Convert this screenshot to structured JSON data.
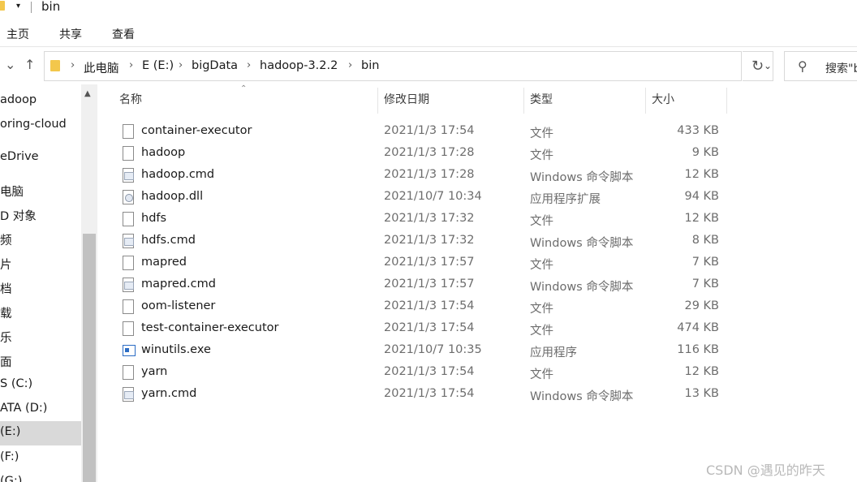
{
  "window": {
    "title": "bin"
  },
  "ribbon": {
    "tabs": [
      "主页",
      "共享",
      "查看"
    ]
  },
  "address": {
    "crumbs": [
      "此电脑",
      "E (E:)",
      "bigData",
      "hadoop-3.2.2",
      "bin"
    ]
  },
  "search": {
    "placeholder": "搜索\"b"
  },
  "sidebar": {
    "items": [
      {
        "label": "adoop"
      },
      {
        "label": "oring-cloud"
      },
      {
        "label": "eDrive"
      },
      {
        "label": "电脑"
      },
      {
        "label": "D 对象"
      },
      {
        "label": "频"
      },
      {
        "label": "片"
      },
      {
        "label": "档"
      },
      {
        "label": "载"
      },
      {
        "label": "乐"
      },
      {
        "label": "面"
      },
      {
        "label": "S (C:)"
      },
      {
        "label": "ATA (D:)"
      },
      {
        "label": "(E:)",
        "selected": true
      },
      {
        "label": "(F:)"
      },
      {
        "label": "(G:)"
      }
    ]
  },
  "columns": {
    "name": "名称",
    "date": "修改日期",
    "type": "类型",
    "size": "大小"
  },
  "files": [
    {
      "name": "container-executor",
      "date": "2021/1/3 17:54",
      "type": "文件",
      "size": "433 KB",
      "icon": "file-icon"
    },
    {
      "name": "hadoop",
      "date": "2021/1/3 17:28",
      "type": "文件",
      "size": "9 KB",
      "icon": "file-icon"
    },
    {
      "name": "hadoop.cmd",
      "date": "2021/1/3 17:28",
      "type": "Windows 命令脚本",
      "size": "12 KB",
      "icon": "cmd-file-icon"
    },
    {
      "name": "hadoop.dll",
      "date": "2021/10/7 10:34",
      "type": "应用程序扩展",
      "size": "94 KB",
      "icon": "dll-file-icon"
    },
    {
      "name": "hdfs",
      "date": "2021/1/3 17:32",
      "type": "文件",
      "size": "12 KB",
      "icon": "file-icon"
    },
    {
      "name": "hdfs.cmd",
      "date": "2021/1/3 17:32",
      "type": "Windows 命令脚本",
      "size": "8 KB",
      "icon": "cmd-file-icon"
    },
    {
      "name": "mapred",
      "date": "2021/1/3 17:57",
      "type": "文件",
      "size": "7 KB",
      "icon": "file-icon"
    },
    {
      "name": "mapred.cmd",
      "date": "2021/1/3 17:57",
      "type": "Windows 命令脚本",
      "size": "7 KB",
      "icon": "cmd-file-icon"
    },
    {
      "name": "oom-listener",
      "date": "2021/1/3 17:54",
      "type": "文件",
      "size": "29 KB",
      "icon": "file-icon"
    },
    {
      "name": "test-container-executor",
      "date": "2021/1/3 17:54",
      "type": "文件",
      "size": "474 KB",
      "icon": "file-icon"
    },
    {
      "name": "winutils.exe",
      "date": "2021/10/7 10:35",
      "type": "应用程序",
      "size": "116 KB",
      "icon": "exe-file-icon"
    },
    {
      "name": "yarn",
      "date": "2021/1/3 17:54",
      "type": "文件",
      "size": "12 KB",
      "icon": "file-icon"
    },
    {
      "name": "yarn.cmd",
      "date": "2021/1/3 17:54",
      "type": "Windows 命令脚本",
      "size": "13 KB",
      "icon": "cmd-file-icon"
    }
  ],
  "watermark": "CSDN @遇见的昨天"
}
